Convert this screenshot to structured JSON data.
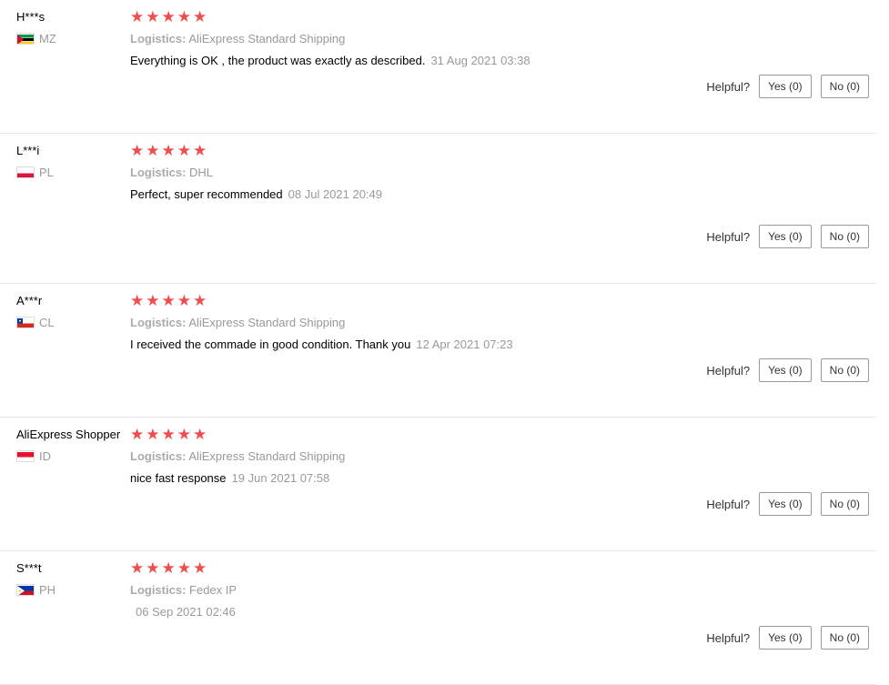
{
  "labels": {
    "logistics": "Logistics:",
    "helpful": "Helpful?"
  },
  "reviews": [
    {
      "user": "H***s",
      "country": "MZ",
      "flag": "mz",
      "stars": 5,
      "logistics": "AliExpress Standard Shipping",
      "text": "Everything is OK , the product was exactly as described.",
      "date": "31 Aug 2021 03:38",
      "yes": "Yes (0)",
      "no": "No (0)"
    },
    {
      "user": "L***i",
      "country": "PL",
      "flag": "pl",
      "stars": 5,
      "logistics": "DHL",
      "text": "Perfect, super recommended",
      "date": "08 Jul 2021 20:49",
      "yes": "Yes (0)",
      "no": "No (0)"
    },
    {
      "user": "A***r",
      "country": "CL",
      "flag": "cl",
      "stars": 5,
      "logistics": "AliExpress Standard Shipping",
      "text": "I received the commade in good condition. Thank you",
      "date": "12 Apr 2021 07:23",
      "yes": "Yes (0)",
      "no": "No (0)"
    },
    {
      "user": "AliExpress Shopper",
      "country": "ID",
      "flag": "id",
      "stars": 5,
      "logistics": "AliExpress Standard Shipping",
      "text": "nice fast response",
      "date": "19 Jun 2021 07:58",
      "yes": "Yes (0)",
      "no": "No (0)"
    },
    {
      "user": "S***t",
      "country": "PH",
      "flag": "ph",
      "stars": 5,
      "logistics": "Fedex IP",
      "text": "",
      "date": "06 Sep 2021 02:46",
      "yes": "Yes (0)",
      "no": "No (0)"
    }
  ]
}
